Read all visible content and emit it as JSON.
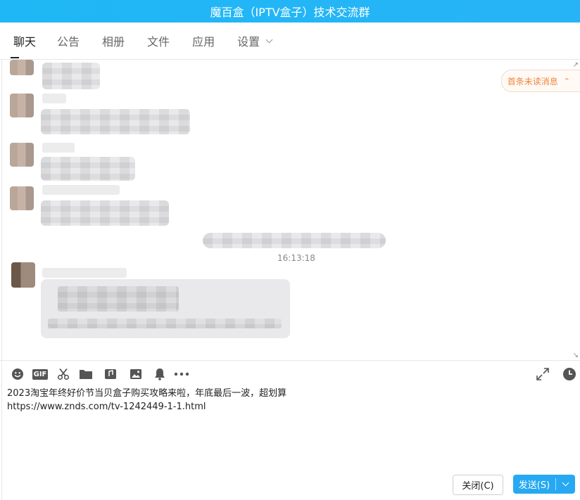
{
  "window": {
    "title": "魔百盒（IPTV盒子）技术交流群"
  },
  "tabs": [
    {
      "label": "聊天",
      "active": true
    },
    {
      "label": "公告"
    },
    {
      "label": "相册"
    },
    {
      "label": "文件"
    },
    {
      "label": "应用"
    },
    {
      "label": "设置"
    }
  ],
  "chat": {
    "unread_label": "首条未读消息",
    "unread_arrow": "⌃",
    "timestamp": "16:13:18"
  },
  "toolbar": {
    "icons": [
      "emoji-icon",
      "gif-icon",
      "scissors-icon",
      "folder-icon",
      "music-icon",
      "image-icon",
      "bell-icon",
      "more-icon",
      "expand-icon",
      "clock-icon"
    ],
    "gif_text": "GIF"
  },
  "editor": {
    "line1": "2023淘宝年终好价节当贝盒子购买攻略来啦，年底最后一波，超划算",
    "line2": "https://www.znds.com/tv-1242449-1-1.html"
  },
  "buttons": {
    "close_label": "关闭(C)",
    "send_label": "发送(S)"
  },
  "colors": {
    "accent": "#26a9f2",
    "titlebar": "#1fb7f5",
    "unread": "#f0843c"
  }
}
